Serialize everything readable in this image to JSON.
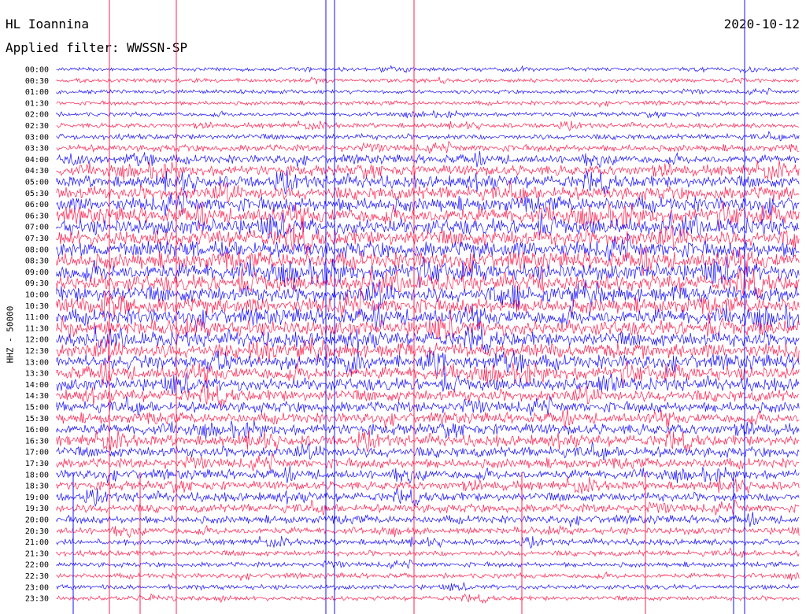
{
  "header": {
    "station": "HL Ioannina",
    "filter": "Applied filter: WWSSN-SP",
    "date": "2020-10-12"
  },
  "colors": {
    "red": "#ff2050",
    "blue": "#1a10ff"
  },
  "chart_data": {
    "type": "line",
    "title": "HL Ioannina",
    "subtitle": "Applied filter: WWSSN-SP",
    "ylabel": "HHZ - 50000",
    "date": "2020-10-12",
    "row_labels": [
      "00:00",
      "00:30",
      "01:00",
      "01:30",
      "02:00",
      "02:30",
      "03:00",
      "03:30",
      "04:00",
      "04:30",
      "05:00",
      "05:30",
      "06:00",
      "06:30",
      "07:00",
      "07:30",
      "08:00",
      "08:30",
      "09:00",
      "09:30",
      "10:00",
      "10:30",
      "11:00",
      "11:30",
      "12:00",
      "12:30",
      "13:00",
      "13:30",
      "14:00",
      "14:30",
      "15:00",
      "15:30",
      "16:00",
      "16:30",
      "17:00",
      "17:30",
      "18:00",
      "18:30",
      "19:00",
      "19:30",
      "20:00",
      "20:30",
      "21:00",
      "21:30",
      "22:00",
      "22:30",
      "23:00",
      "23:30"
    ],
    "series": [
      {
        "color": "blue"
      },
      {
        "color": "red"
      }
    ],
    "activity_level": [
      0.05,
      0.05,
      0.05,
      0.06,
      0.07,
      0.09,
      0.12,
      0.18,
      0.25,
      0.33,
      0.4,
      0.45,
      0.5,
      0.52,
      0.55,
      0.57,
      0.58,
      0.58,
      0.58,
      0.57,
      0.56,
      0.55,
      0.54,
      0.52,
      0.5,
      0.5,
      0.48,
      0.45,
      0.42,
      0.38,
      0.35,
      0.33,
      0.35,
      0.35,
      0.33,
      0.3,
      0.28,
      0.26,
      0.26,
      0.25,
      0.22,
      0.18,
      0.14,
      0.12,
      0.1,
      0.1,
      0.09,
      0.08
    ],
    "grid": false
  }
}
